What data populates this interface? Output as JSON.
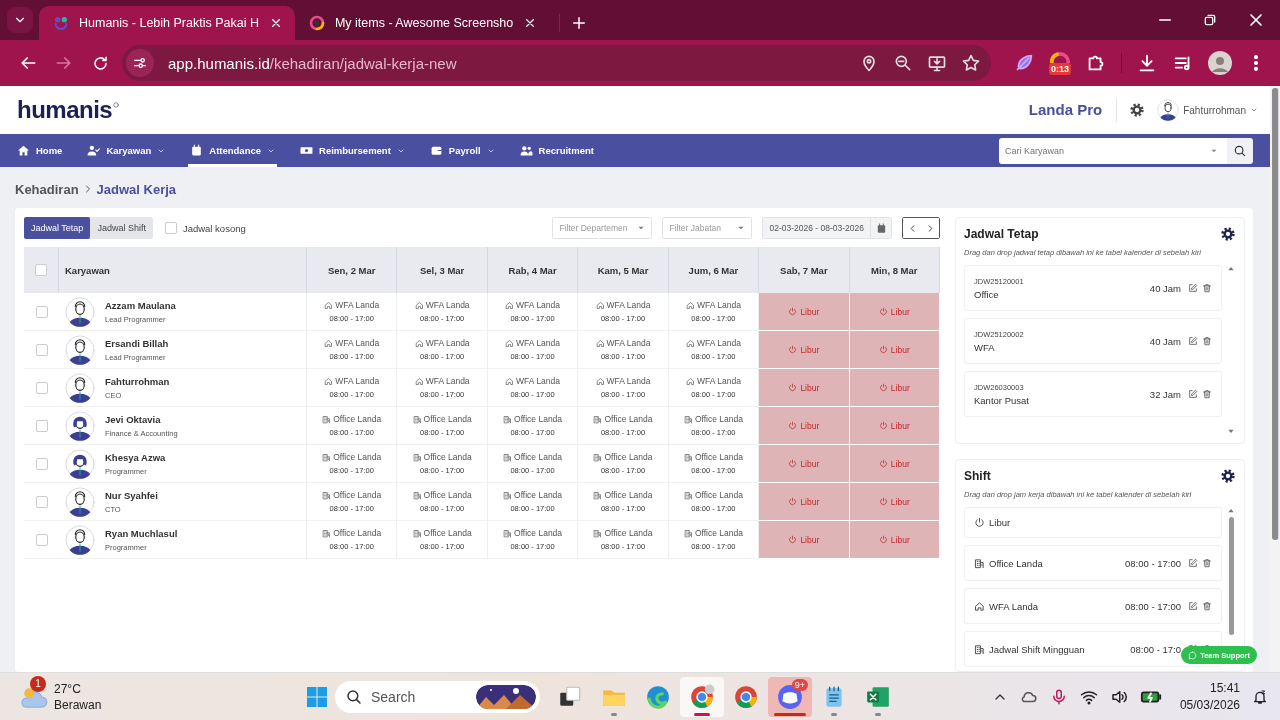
{
  "browser": {
    "tabs": [
      {
        "title": "Humanis - Lebih Praktis Pakai H",
        "selected": true,
        "kind": "humanis"
      },
      {
        "title": "My items - Awesome Screensho",
        "selected": false,
        "kind": "screenshot"
      }
    ],
    "address": {
      "host": "app.humanis.id",
      "path": "/kehadiran/jadwal-kerja-new"
    },
    "extension_badge": "0:13"
  },
  "header": {
    "logo": "humanis",
    "brand": "Landa Pro",
    "user": "Fahturrohman"
  },
  "nav": {
    "items": [
      {
        "label": "Home",
        "dropdown": false,
        "selected": false
      },
      {
        "label": "Karyawan",
        "dropdown": true,
        "selected": false
      },
      {
        "label": "Attendance",
        "dropdown": true,
        "selected": true
      },
      {
        "label": "Reimbursement",
        "dropdown": true,
        "selected": false
      },
      {
        "label": "Payroll",
        "dropdown": true,
        "selected": false
      },
      {
        "label": "Recruitment",
        "dropdown": false,
        "selected": false
      }
    ],
    "search": {
      "placeholder": "Cari Karyawan"
    }
  },
  "breadcrumb": [
    {
      "label": "Kehadiran",
      "current": false
    },
    {
      "label": "Jadwal Kerja",
      "current": true
    }
  ],
  "schedule": {
    "view_tabs": [
      {
        "label": "Jadwal Tetap",
        "selected": true
      },
      {
        "label": "Jadwal Shift",
        "selected": false
      }
    ],
    "empty_filter": {
      "label": "Jadwal kosong",
      "checked": false
    },
    "filters": [
      {
        "placeholder": "Filter Departemen"
      },
      {
        "placeholder": "Filter Jabatan"
      }
    ],
    "date_range": "02-03-2026 - 08-03-2026",
    "select_all": {
      "checked": false
    },
    "columns": [
      "Karyawan",
      "Sen, 2 Mar",
      "Sel, 3 Mar",
      "Rab, 4 Mar",
      "Kam, 5 Mar",
      "Jum, 6 Mar",
      "Sab, 7 Mar",
      "Min, 8 Mar"
    ],
    "rows": [
      {
        "kind": "man",
        "checked": false,
        "cells": [
          {
            "kind": "employee",
            "name": "Azzam Maulana",
            "role": "Lead Programmer"
          },
          {
            "kind": "wfa",
            "label": "WFA Landa",
            "time": "08:00 - 17:00"
          },
          {
            "kind": "wfa",
            "label": "WFA Landa",
            "time": "08:00 - 17:00"
          },
          {
            "kind": "wfa",
            "label": "WFA Landa",
            "time": "08:00 - 17:00"
          },
          {
            "kind": "wfa",
            "label": "WFA Landa",
            "time": "08:00 - 17:00"
          },
          {
            "kind": "wfa",
            "label": "WFA Landa",
            "time": "08:00 - 17:00"
          },
          {
            "kind": "off",
            "label": "Libur"
          },
          {
            "kind": "off",
            "label": "Libur"
          }
        ]
      },
      {
        "kind": "man",
        "checked": false,
        "cells": [
          {
            "kind": "employee",
            "name": "Ersandi Billah",
            "role": "Lead Programmer"
          },
          {
            "kind": "wfa",
            "label": "WFA Landa",
            "time": "08:00 - 17:00"
          },
          {
            "kind": "wfa",
            "label": "WFA Landa",
            "time": "08:00 - 17:00"
          },
          {
            "kind": "wfa",
            "label": "WFA Landa",
            "time": "08:00 - 17:00"
          },
          {
            "kind": "wfa",
            "label": "WFA Landa",
            "time": "08:00 - 17:00"
          },
          {
            "kind": "wfa",
            "label": "WFA Landa",
            "time": "08:00 - 17:00"
          },
          {
            "kind": "off",
            "label": "Libur"
          },
          {
            "kind": "off",
            "label": "Libur"
          }
        ]
      },
      {
        "kind": "man",
        "checked": false,
        "cells": [
          {
            "kind": "employee",
            "name": "Fahturrohman",
            "role": "CEO"
          },
          {
            "kind": "wfa",
            "label": "WFA Landa",
            "time": "08:00 - 17:00"
          },
          {
            "kind": "wfa",
            "label": "WFA Landa",
            "time": "08:00 - 17:00"
          },
          {
            "kind": "wfa",
            "label": "WFA Landa",
            "time": "08:00 - 17:00"
          },
          {
            "kind": "wfa",
            "label": "WFA Landa",
            "time": "08:00 - 17:00"
          },
          {
            "kind": "wfa",
            "label": "WFA Landa",
            "time": "08:00 - 17:00"
          },
          {
            "kind": "off",
            "label": "Libur"
          },
          {
            "kind": "off",
            "label": "Libur"
          }
        ]
      },
      {
        "kind": "woman",
        "checked": false,
        "cells": [
          {
            "kind": "employee",
            "name": "Jevi Oktavia",
            "role": "Finance & Accounting"
          },
          {
            "kind": "office",
            "label": "Office Landa",
            "time": "08:00 - 17:00"
          },
          {
            "kind": "office",
            "label": "Office Landa",
            "time": "08:00 - 17:00"
          },
          {
            "kind": "office",
            "label": "Office Landa",
            "time": "08:00 - 17:00"
          },
          {
            "kind": "office",
            "label": "Office Landa",
            "time": "08:00 - 17:00"
          },
          {
            "kind": "office",
            "label": "Office Landa",
            "time": "08:00 - 17:00"
          },
          {
            "kind": "off",
            "label": "Libur"
          },
          {
            "kind": "off",
            "label": "Libur"
          }
        ]
      },
      {
        "kind": "woman",
        "checked": false,
        "cells": [
          {
            "kind": "employee",
            "name": "Khesya Azwa",
            "role": "Programmer"
          },
          {
            "kind": "office",
            "label": "Office Landa",
            "time": "08:00 - 17:00"
          },
          {
            "kind": "office",
            "label": "Office Landa",
            "time": "08:00 - 17:00"
          },
          {
            "kind": "office",
            "label": "Office Landa",
            "time": "08:00 - 17:00"
          },
          {
            "kind": "office",
            "label": "Office Landa",
            "time": "08:00 - 17:00"
          },
          {
            "kind": "office",
            "label": "Office Landa",
            "time": "08:00 - 17:00"
          },
          {
            "kind": "off",
            "label": "Libur"
          },
          {
            "kind": "off",
            "label": "Libur"
          }
        ]
      },
      {
        "kind": "man",
        "checked": false,
        "cells": [
          {
            "kind": "employee",
            "name": "Nur Syahfei",
            "role": "CTO"
          },
          {
            "kind": "office",
            "label": "Office Landa",
            "time": "08:00 - 17:00"
          },
          {
            "kind": "office",
            "label": "Office Landa",
            "time": "08:00 - 17:00"
          },
          {
            "kind": "office",
            "label": "Office Landa",
            "time": "08:00 - 17:00"
          },
          {
            "kind": "office",
            "label": "Office Landa",
            "time": "08:00 - 17:00"
          },
          {
            "kind": "office",
            "label": "Office Landa",
            "time": "08:00 - 17:00"
          },
          {
            "kind": "off",
            "label": "Libur"
          },
          {
            "kind": "off",
            "label": "Libur"
          }
        ]
      },
      {
        "kind": "man",
        "checked": false,
        "cells": [
          {
            "kind": "employee",
            "name": "Ryan Muchlasul",
            "role": "Programmer"
          },
          {
            "kind": "office",
            "label": "Office Landa",
            "time": "08:00 - 17:00"
          },
          {
            "kind": "office",
            "label": "Office Landa",
            "time": "08:00 - 17:00"
          },
          {
            "kind": "office",
            "label": "Office Landa",
            "time": "08:00 - 17:00"
          },
          {
            "kind": "office",
            "label": "Office Landa",
            "time": "08:00 - 17:00"
          },
          {
            "kind": "office",
            "label": "Office Landa",
            "time": "08:00 - 17:00"
          },
          {
            "kind": "off",
            "label": "Libur"
          },
          {
            "kind": "off",
            "label": "Libur"
          }
        ]
      }
    ]
  },
  "fixed_schedules": {
    "title": "Jadwal Tetap",
    "hint": "Drag dan drop jadwal tetap dibawah ini ke tabel kalender di sebelah kiri",
    "items": [
      {
        "code": "JDW25120001",
        "name": "Office",
        "hours": "40 Jam"
      },
      {
        "code": "JDW25120002",
        "name": "WFA",
        "hours": "40 Jam"
      },
      {
        "code": "JDW26030003",
        "name": "Kantor Pusat",
        "hours": "32 Jam"
      }
    ]
  },
  "shifts": {
    "title": "Shift",
    "hint": "Drag dan drop jam kerja dibawah ini ke tabel kalender di sebelah kiri",
    "items": [
      {
        "kind": "off",
        "name": "Libur"
      },
      {
        "kind": "office",
        "name": "Office Landa",
        "time": "08:00 - 17:00"
      },
      {
        "kind": "wfa",
        "name": "WFA Landa",
        "time": "08:00 - 17:00"
      },
      {
        "kind": "office",
        "name": "Jadwal Shift Mingguan",
        "time": "08:00 - 17:0"
      }
    ]
  },
  "support_button": "Team Support",
  "taskbar": {
    "weather": {
      "temp": "27°C",
      "condition": "Berawan",
      "badge": "1"
    },
    "search": "Search",
    "apps": [
      {
        "kind": "taskview",
        "running": false,
        "selected": false,
        "alert": false
      },
      {
        "kind": "files",
        "running": true,
        "selected": false,
        "alert": false
      },
      {
        "kind": "edge",
        "running": false,
        "selected": false,
        "alert": false
      },
      {
        "kind": "chrome_profile",
        "running": true,
        "selected": true,
        "alert": false
      },
      {
        "kind": "chrome",
        "running": false,
        "selected": false,
        "alert": false
      },
      {
        "kind": "discord",
        "running": true,
        "selected": false,
        "alert": true,
        "badge": "9+"
      },
      {
        "kind": "notepad",
        "running": true,
        "selected": false,
        "alert": false
      },
      {
        "kind": "excel",
        "running": true,
        "selected": false,
        "alert": false
      }
    ],
    "clock": {
      "time": "15:41",
      "date": "05/03/2026"
    }
  }
}
